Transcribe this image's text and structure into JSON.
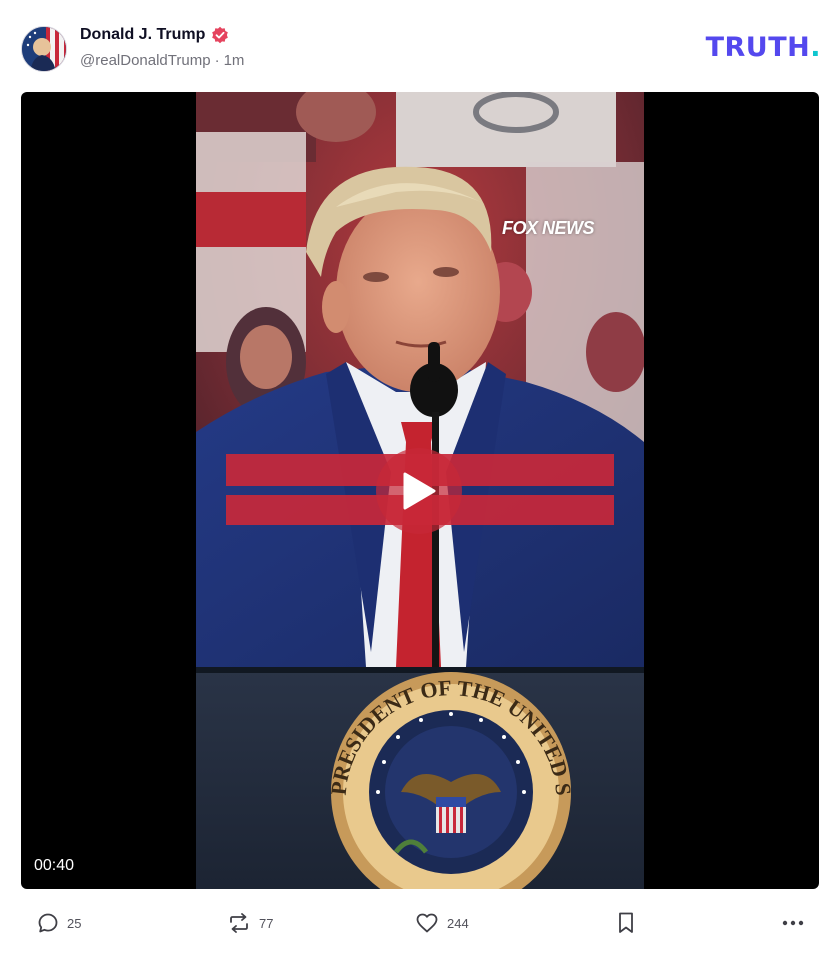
{
  "post": {
    "display_name": "Donald J. Trump",
    "handle": "@realDonaldTrump",
    "separator": "·",
    "time_ago": "1m",
    "verified": true
  },
  "brand": {
    "wordmark": "TRUTH",
    "wordmark_dot": ".",
    "primary_color": "#5448ee",
    "dot_color": "#0fc6cf"
  },
  "video": {
    "watermark": "FOX NEWS",
    "duration": "00:40",
    "seal_text": "PRESIDENT OF THE UNITED STATES",
    "play_icon": "play-icon"
  },
  "actions": {
    "replies": "25",
    "retruths": "77",
    "likes": "244",
    "icons": [
      "reply-icon",
      "retruth-icon",
      "like-icon",
      "bookmark-icon",
      "more-icon"
    ]
  }
}
